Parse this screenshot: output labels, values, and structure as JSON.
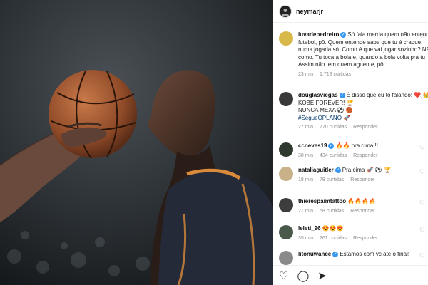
{
  "post": {
    "username": "neymarjr"
  },
  "comments": [
    {
      "username": "luvadepedreiro",
      "verified": true,
      "lines": [
        "Só fala merda quem não entende",
        "futebol, pô. Quem entende sabe que tu é craque,",
        "numa jogada só. Como é que vai jogar sozinho? Não tem",
        "como. Tu toca a bola e, quando a bola volta pra tu",
        "Assim não tem quem aguente, pô."
      ],
      "time": "23 min",
      "likes": "1.718 curtidas",
      "reply": ""
    },
    {
      "username": "douglasviegas",
      "verified": true,
      "lines": [
        "É disso que eu to falando! ❤️ 👑",
        "KOBE FOREVER! 🏆",
        "NUNCA MEXA ⚽ 🏀",
        "#SegueOPLANO 🚀"
      ],
      "time": "27 min",
      "likes": "770 curtidas",
      "reply": "Responder"
    },
    {
      "username": "ccneves19",
      "verified": true,
      "lines": [
        "🔥🔥 pra cima!!!"
      ],
      "time": "38 min",
      "likes": "434 curtidas",
      "reply": "Responder"
    },
    {
      "username": "nataliaguitler",
      "verified": true,
      "lines": [
        "Pra cima 🚀 ⚽ 🏆"
      ],
      "time": "18 min",
      "likes": "78 curtidas",
      "reply": "Responder"
    },
    {
      "username": "thierespaimtattoo",
      "verified": false,
      "lines": [
        "🔥🔥🔥🔥"
      ],
      "time": "21 min",
      "likes": "68 curtidas",
      "reply": "Responder"
    },
    {
      "username": "leleti_96",
      "verified": false,
      "lines": [
        "😍😍😍"
      ],
      "time": "35 min",
      "likes": "261 curtidas",
      "reply": "Responder"
    },
    {
      "username": "litonuwance",
      "verified": true,
      "lines": [
        "Estamos com vc até o final!"
      ],
      "time": "",
      "likes": "",
      "reply": ""
    }
  ],
  "icons": {
    "like": "heart-icon",
    "comment": "comment-icon",
    "share": "share-icon",
    "verified": "verified-badge-icon"
  },
  "colors": {
    "verified": "#3897f0",
    "hashtag": "#00376b"
  }
}
